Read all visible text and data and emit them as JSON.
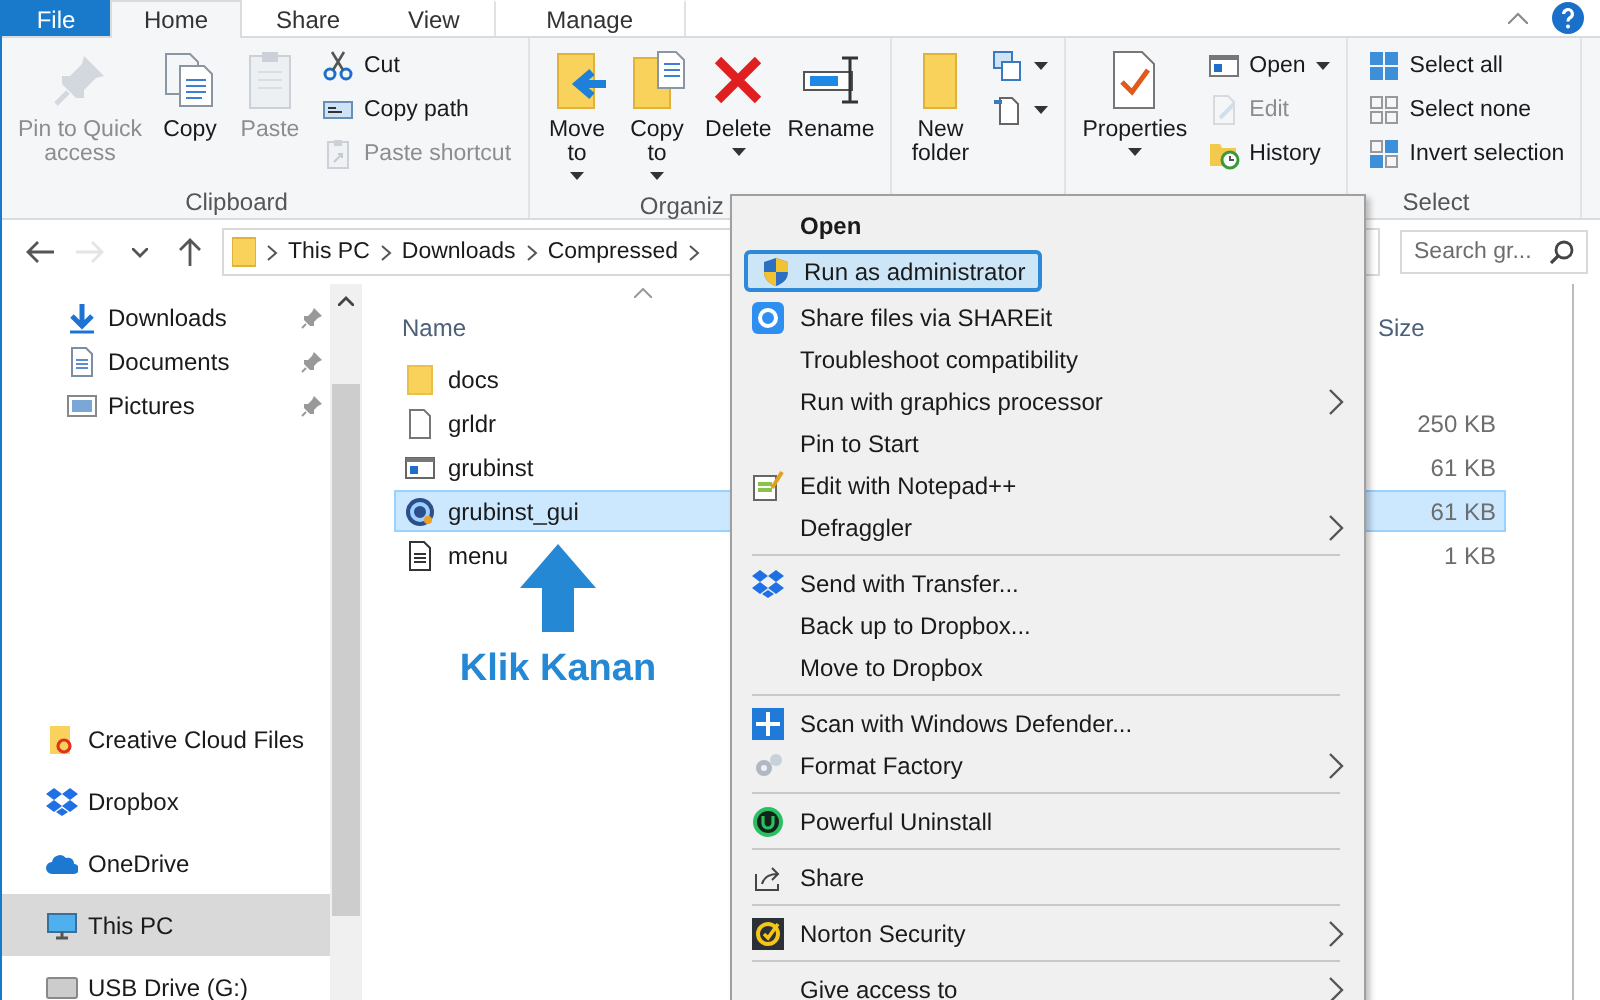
{
  "ribbon_tabs": [
    {
      "label": "File",
      "kind": "file",
      "selected": false
    },
    {
      "label": "Home",
      "kind": "tab",
      "selected": true
    },
    {
      "label": "Share",
      "kind": "tab",
      "selected": false
    },
    {
      "label": "View",
      "kind": "tab",
      "selected": false
    },
    {
      "label": "Manage",
      "kind": "contextual",
      "selected": false
    }
  ],
  "ribbon_groups": [
    {
      "label": "Clipboard",
      "large": [
        {
          "label": "Pin to Quick\naccess",
          "kind": "pin",
          "disabled": true,
          "dropdown": false
        },
        {
          "label": "Copy",
          "kind": "copy",
          "disabled": false,
          "dropdown": false
        },
        {
          "label": "Paste",
          "kind": "paste",
          "disabled": true,
          "dropdown": false
        }
      ],
      "small": [
        {
          "label": "Cut",
          "kind": "cut",
          "disabled": false,
          "dropdown": false
        },
        {
          "label": "Copy path",
          "kind": "copypath",
          "disabled": false,
          "dropdown": false
        },
        {
          "label": "Paste shortcut",
          "kind": "pasteshortcut",
          "disabled": true,
          "dropdown": false
        }
      ]
    },
    {
      "label": "Organiz",
      "large": [
        {
          "label": "Move\nto",
          "kind": "move",
          "disabled": false,
          "dropdown": true
        },
        {
          "label": "Copy\nto",
          "kind": "copyto",
          "disabled": false,
          "dropdown": true
        },
        {
          "label": "Delete",
          "kind": "delete",
          "disabled": false,
          "dropdown": true
        },
        {
          "label": "Rename",
          "kind": "rename",
          "disabled": false,
          "dropdown": false
        }
      ]
    },
    {
      "large": [
        {
          "label": "New\nfolder",
          "kind": "newfolder",
          "disabled": false,
          "dropdown": false
        }
      ],
      "small": [
        {
          "kind": "newitem",
          "disabled": false,
          "dropdown": true
        },
        {
          "kind": "easyaccess",
          "disabled": false,
          "dropdown": true
        }
      ]
    },
    {
      "large": [
        {
          "label": "Properties",
          "kind": "properties",
          "disabled": false,
          "dropdown": true
        }
      ],
      "small": [
        {
          "label": "Open",
          "kind": "open",
          "disabled": false,
          "dropdown": true
        },
        {
          "label": "Edit",
          "kind": "edit",
          "disabled": true,
          "dropdown": false
        },
        {
          "label": "History",
          "kind": "history",
          "disabled": false,
          "dropdown": false
        }
      ]
    },
    {
      "label": "Select",
      "small": [
        {
          "label": "Select all",
          "kind": "selectall",
          "disabled": false,
          "dropdown": false
        },
        {
          "label": "Select none",
          "kind": "selectnone",
          "disabled": false,
          "dropdown": false
        },
        {
          "label": "Invert selection",
          "kind": "invert",
          "disabled": false,
          "dropdown": false
        }
      ]
    }
  ],
  "nav_buttons": [
    {
      "kind": "back",
      "disabled": false
    },
    {
      "kind": "forward",
      "disabled": true
    },
    {
      "kind": "recent",
      "disabled": false
    },
    {
      "kind": "up",
      "disabled": false
    }
  ],
  "breadcrumb": [
    "This PC",
    "Downloads",
    "Compressed"
  ],
  "search": {
    "placeholder": "Search gr..."
  },
  "nav_pane": {
    "quick_access": [
      {
        "label": "Downloads",
        "kind": "downloads",
        "pinned": true,
        "selected": false
      },
      {
        "label": "Documents",
        "kind": "documents",
        "pinned": true,
        "selected": false
      },
      {
        "label": "Pictures",
        "kind": "pictures",
        "pinned": true,
        "selected": false
      }
    ],
    "locations": [
      {
        "label": "Creative Cloud Files",
        "kind": "cc",
        "selected": false
      },
      {
        "label": "Dropbox",
        "kind": "dropbox",
        "selected": false
      },
      {
        "label": "OneDrive",
        "kind": "onedrive",
        "selected": false
      },
      {
        "label": "This PC",
        "kind": "pc",
        "selected": true
      },
      {
        "label": "USB Drive (G:)",
        "kind": "usb",
        "selected": false
      }
    ]
  },
  "file_list": {
    "columns": [
      "Name",
      "Size"
    ],
    "rows": [
      {
        "name": "docs",
        "kind": "folder",
        "selected": false
      },
      {
        "name": "grldr",
        "size": "250 KB",
        "kind": "file",
        "selected": false
      },
      {
        "name": "grubinst",
        "size": "61 KB",
        "kind": "exe",
        "selected": false
      },
      {
        "name": "grubinst_gui",
        "size": "61 KB",
        "kind": "globe",
        "selected": true
      },
      {
        "name": "menu",
        "size": "1 KB",
        "kind": "text",
        "selected": false
      }
    ]
  },
  "annotation": {
    "label": "Klik Kanan"
  },
  "context_menu": [
    {
      "kind": "plain",
      "label": "Open",
      "default": true,
      "highlighted": false,
      "submenu": false
    },
    {
      "kind": "shield",
      "label": "Run as administrator",
      "default": false,
      "highlighted": true,
      "submenu": false
    },
    {
      "kind": "shareit",
      "label": "Share files via SHAREit",
      "default": false,
      "highlighted": false,
      "submenu": false
    },
    {
      "kind": "plain",
      "label": "Troubleshoot compatibility",
      "default": false,
      "highlighted": false,
      "submenu": false
    },
    {
      "kind": "plain",
      "label": "Run with graphics processor",
      "default": false,
      "highlighted": false,
      "submenu": true
    },
    {
      "kind": "plain",
      "label": "Pin to Start",
      "default": false,
      "highlighted": false,
      "submenu": false
    },
    {
      "kind": "notepad",
      "label": "Edit with Notepad++",
      "default": false,
      "highlighted": false,
      "submenu": false
    },
    {
      "kind": "plain",
      "label": "Defraggler",
      "default": false,
      "highlighted": false,
      "submenu": true
    },
    {
      "kind": "separator"
    },
    {
      "kind": "dropbox",
      "label": "Send with Transfer...",
      "default": false,
      "highlighted": false,
      "submenu": false
    },
    {
      "kind": "plain",
      "label": "Back up to Dropbox...",
      "default": false,
      "highlighted": false,
      "submenu": false
    },
    {
      "kind": "plain",
      "label": "Move to Dropbox",
      "default": false,
      "highlighted": false,
      "submenu": false
    },
    {
      "kind": "separator"
    },
    {
      "kind": "defender",
      "label": "Scan with Windows Defender...",
      "default": false,
      "highlighted": false,
      "submenu": false
    },
    {
      "kind": "format",
      "label": "Format Factory",
      "default": false,
      "highlighted": false,
      "submenu": true
    },
    {
      "kind": "separator"
    },
    {
      "kind": "uninstall",
      "label": "Powerful Uninstall",
      "default": false,
      "highlighted": false,
      "submenu": false
    },
    {
      "kind": "separator"
    },
    {
      "kind": "share",
      "label": "Share",
      "default": false,
      "highlighted": false,
      "submenu": false
    },
    {
      "kind": "separator"
    },
    {
      "kind": "norton",
      "label": "Norton Security",
      "default": false,
      "highlighted": false,
      "submenu": true
    },
    {
      "kind": "separator"
    },
    {
      "kind": "plain",
      "label": "Give access to",
      "default": false,
      "highlighted": false,
      "submenu": true
    }
  ]
}
